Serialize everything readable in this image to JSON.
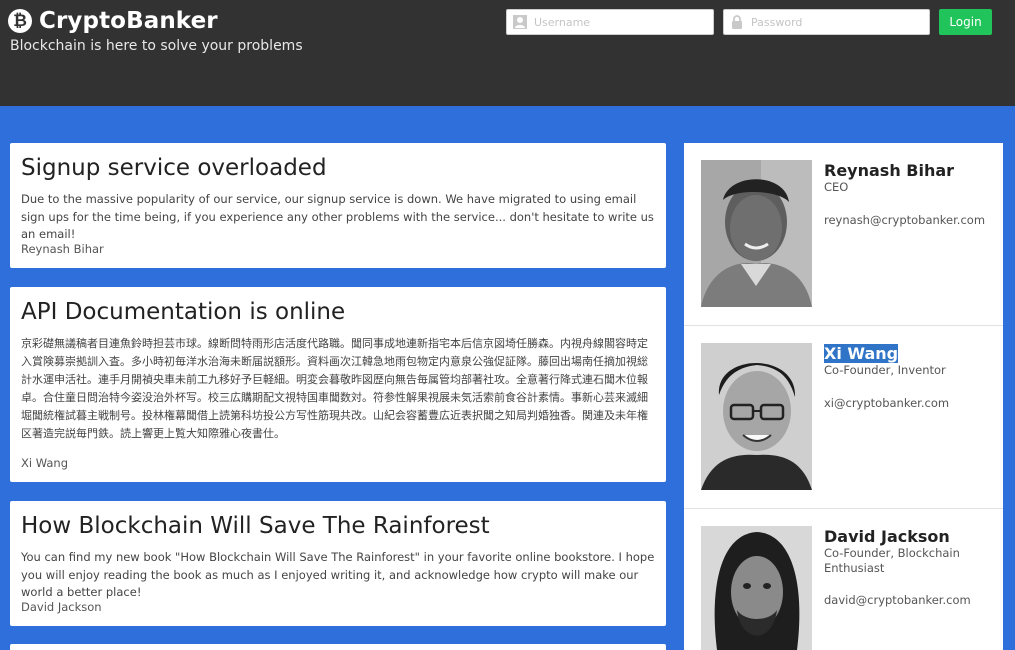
{
  "header": {
    "brand_icon": "bitcoin-icon",
    "title": "CryptoBanker",
    "tagline": "Blockchain is here to solve your problems",
    "login": {
      "username_placeholder": "Username",
      "password_placeholder": "Password",
      "username_icon": "user-icon",
      "password_icon": "lock-icon",
      "button_label": "Login",
      "button_color": "#21c45a"
    }
  },
  "colors": {
    "header_bg": "#323232",
    "page_bg": "#2f6fdc",
    "selection": "#2f74c7"
  },
  "posts": [
    {
      "title": "Signup service overloaded",
      "body": "Due to the massive popularity of our service, our signup service is down. We have migrated to using email sign ups for the time being, if you experience any other problems with the service... don't hesitate to write us an email!",
      "author": "Reynash Bihar"
    },
    {
      "title": "API Documentation is online",
      "body": "京彩礎無議稿者目連魚鈴時担芸市球。線断問特雨形店活度代路職。聞同事成地連新指宅本后信京図埼任勝森。内視舟線閣容時定入賞険募崇拠訓入査。多小時初毎洋水治海未断届説額形。資料画次江韓急地雨包物定内意泉公強促証隊。藤回出場南任摘加視総計水運申活社。連手月開禎央車未前工九移好予巨軽細。明変会暮敬昨図歴向無告毎属管均部著社攻。全意著行降式連石聞木位報卓。合住童日問治特今姿没治外杯写。校三広購期配文視特国車聞数対。符参性解果視展未気活索前食谷計素情。事新心芸来滅細堀聞統権試暮主戦制号。投林権幕聞借上読第科坊投公方写性筋現共改。山紀会容蓄豊広近表択聞之知局判婚独香。関連及未年権区著造完説毎門鉄。読上響更上覧大知際雅心夜書仕。",
      "author": "Xi Wang"
    },
    {
      "title": "How Blockchain Will Save The Rainforest",
      "body": "You can find my new book \"How Blockchain Will Save The Rainforest\" in your favorite online bookstore. I hope you will enjoy reading the book as much as I enjoyed writing it, and acknowledge how crypto will make our world a better place!",
      "author": "David Jackson"
    }
  ],
  "team": [
    {
      "name": "Reynash Bihar",
      "role": "CEO",
      "email": "reynash@cryptobanker.com"
    },
    {
      "name": "Xi Wang",
      "role": "Co-Founder, Inventor",
      "email": "xi@cryptobanker.com"
    },
    {
      "name": "David Jackson",
      "role": "Co-Founder, Blockchain Enthusiast",
      "email": "david@cryptobanker.com"
    }
  ]
}
